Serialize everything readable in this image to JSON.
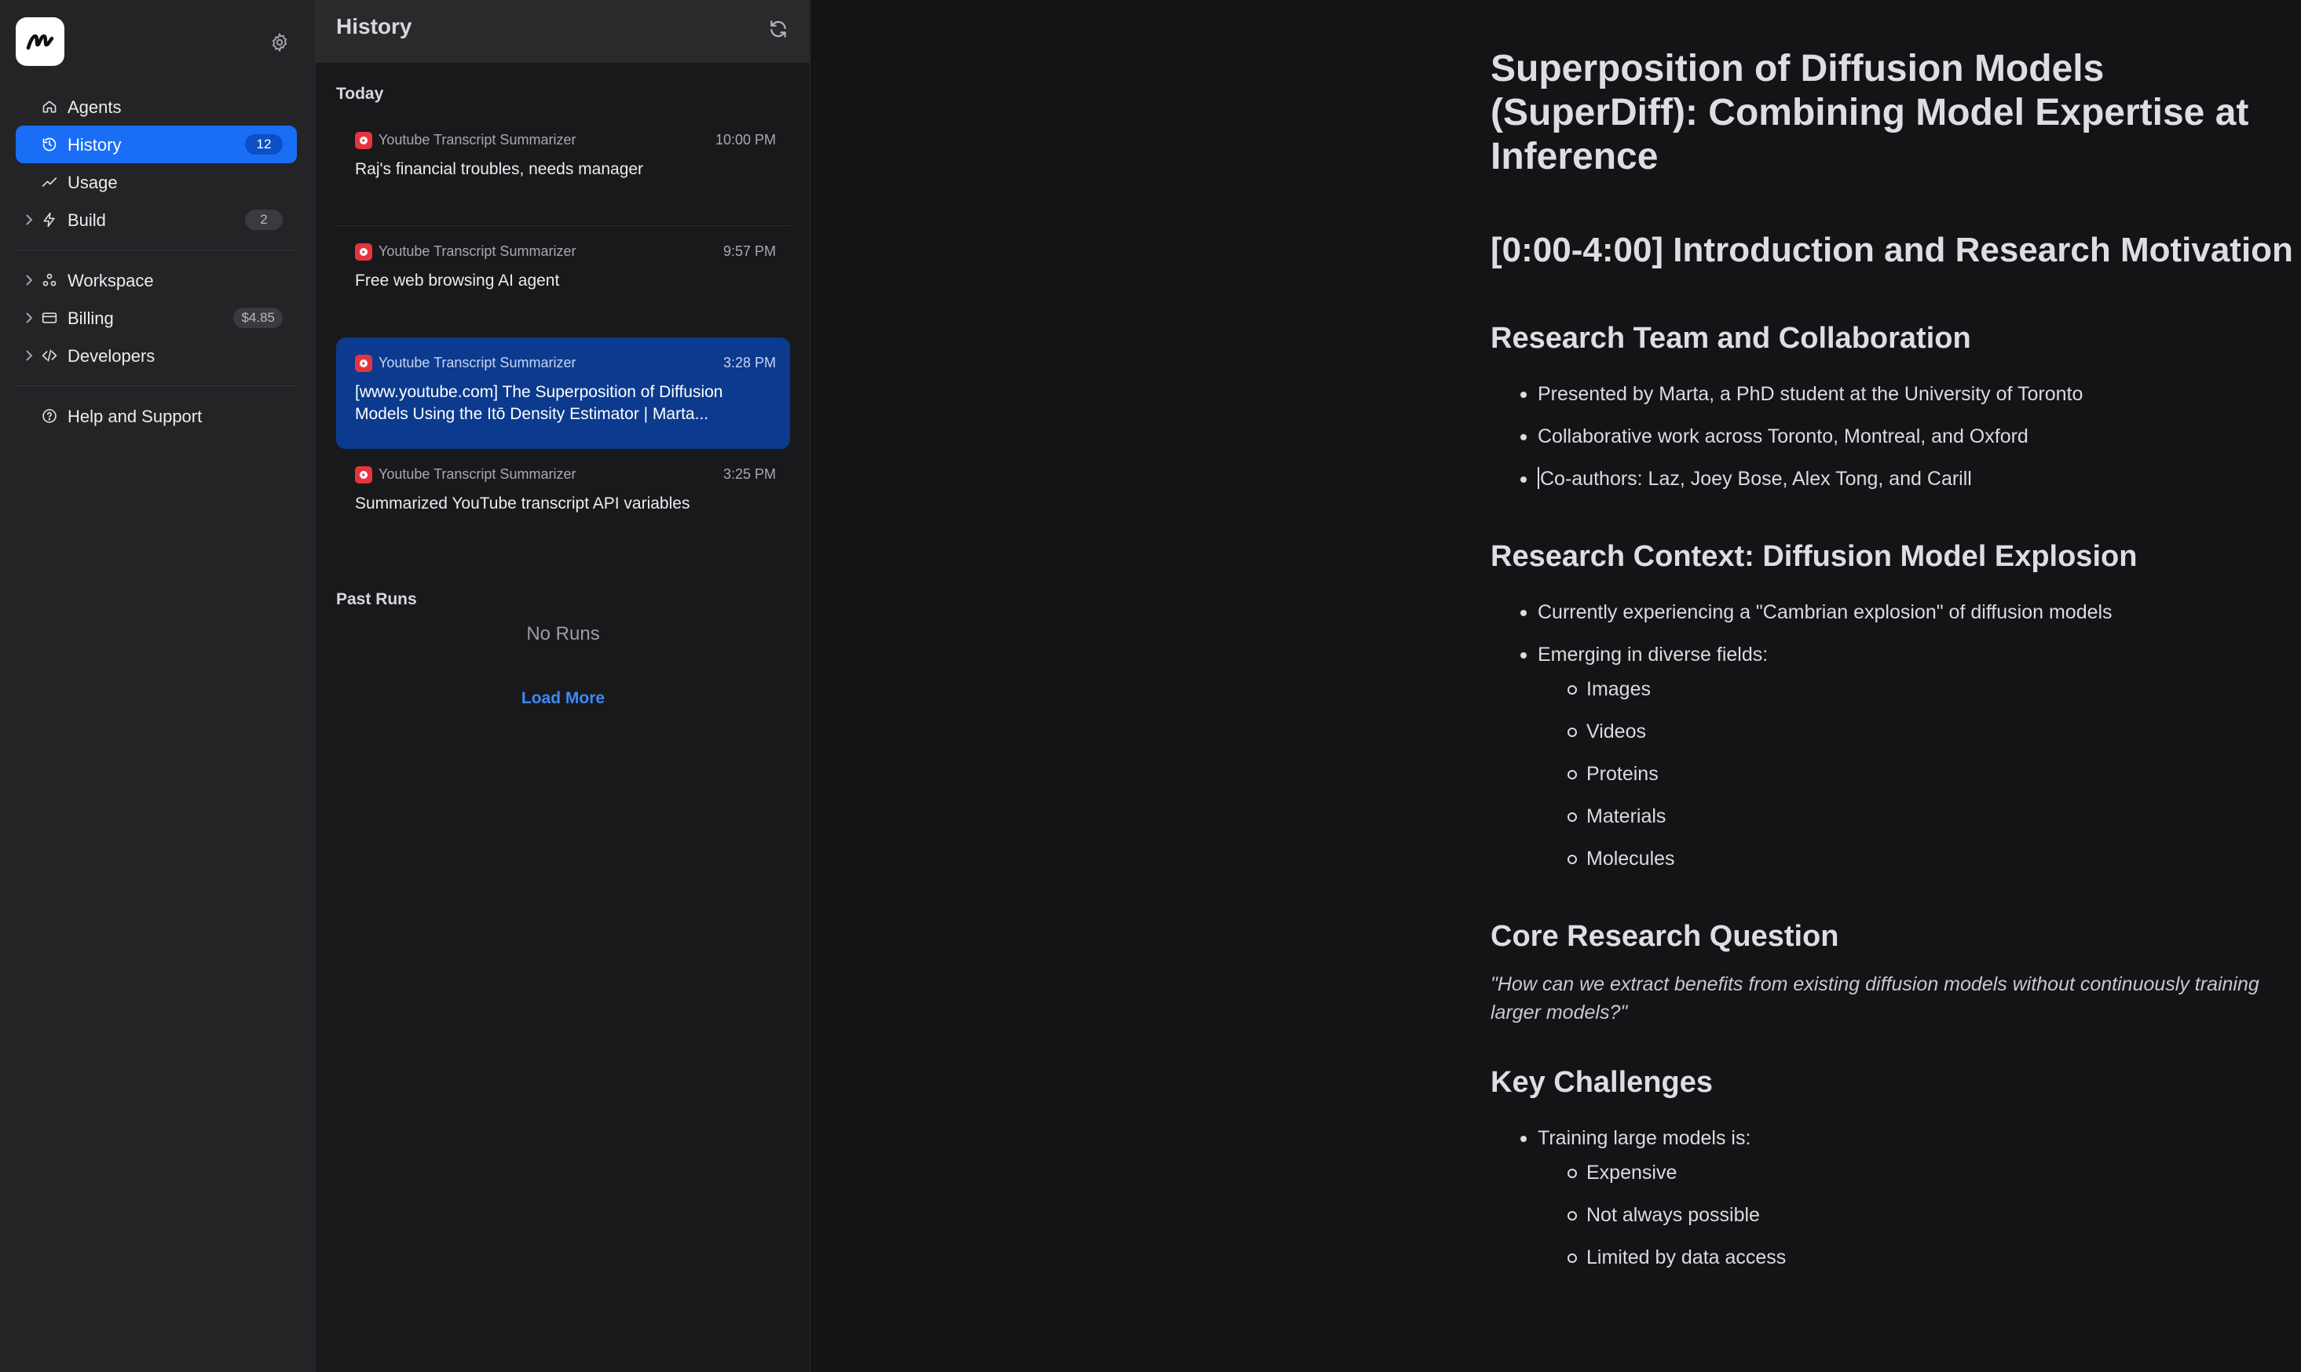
{
  "sidebar": {
    "logo": "m-logo-icon",
    "nav": [
      {
        "label": "Agents",
        "icon": "home-icon"
      },
      {
        "label": "History",
        "icon": "history-icon",
        "badge": "12",
        "active": true
      },
      {
        "label": "Usage",
        "icon": "trend-icon"
      },
      {
        "label": "Build",
        "icon": "bolt-icon",
        "badge": "2",
        "expandable": true
      }
    ],
    "nav2": [
      {
        "label": "Workspace",
        "icon": "workspace-icon",
        "expandable": true
      },
      {
        "label": "Billing",
        "icon": "card-icon",
        "badge": "$4.85",
        "expandable": true
      },
      {
        "label": "Developers",
        "icon": "code-icon",
        "expandable": true
      }
    ],
    "help": {
      "label": "Help and Support",
      "icon": "help-icon"
    }
  },
  "history": {
    "title": "History",
    "today_label": "Today",
    "runs": [
      {
        "app": "Youtube Transcript Summarizer",
        "time": "10:00 PM",
        "title": "Raj's financial troubles, needs manager"
      },
      {
        "app": "Youtube Transcript Summarizer",
        "time": "9:57 PM",
        "title": "Free web browsing AI agent"
      },
      {
        "app": "Youtube Transcript Summarizer",
        "time": "3:28 PM",
        "title": "[www.youtube.com] The Superposition of Diffusion Models Using the Itō Density Estimator | Marta...",
        "selected": true
      },
      {
        "app": "Youtube Transcript Summarizer",
        "time": "3:25 PM",
        "title": "Summarized YouTube transcript API variables"
      }
    ],
    "past_label": "Past Runs",
    "no_runs": "No Runs",
    "load_more": "Load More"
  },
  "doc": {
    "title": "Superposition of Diffusion Models (SuperDiff): Combining Model Expertise at Inference",
    "section1": "[0:00-4:00] Introduction and Research Motivation",
    "team": {
      "heading": "Research Team and Collaboration",
      "items": [
        "Presented by Marta, a PhD student at the University of Toronto",
        "Collaborative work across Toronto, Montreal, and Oxford",
        "Co-authors: Laz, Joey Bose, Alex Tong, and Carill"
      ]
    },
    "context": {
      "heading": "Research Context: Diffusion Model Explosion",
      "item1": "Currently experiencing a \"Cambrian explosion\" of diffusion models",
      "item2": "Emerging in diverse fields:",
      "fields": [
        "Images",
        "Videos",
        "Proteins",
        "Materials",
        "Molecules"
      ]
    },
    "question": {
      "heading": "Core Research Question",
      "quote": "\"How can we extract benefits from existing diffusion models without continuously training larger models?\""
    },
    "challenges": {
      "heading": "Key Challenges",
      "item1": "Training large models is:",
      "sub": [
        "Expensive",
        "Not always possible",
        "Limited by data access"
      ]
    }
  },
  "colors": {
    "accent": "#1a6ef5",
    "selected_card": "#0b3a8e",
    "app_icon": "#e6343f",
    "link": "#3b8bf3"
  }
}
